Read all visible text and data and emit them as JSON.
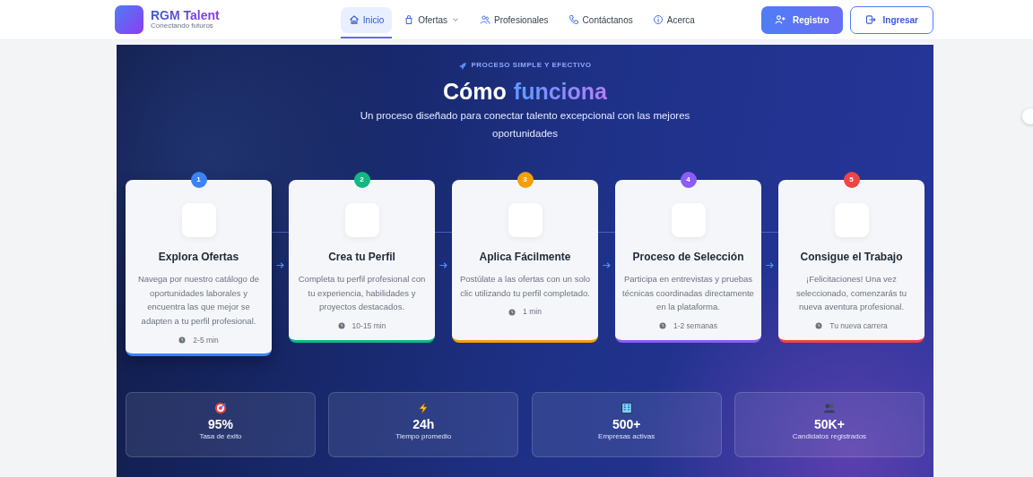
{
  "brand": {
    "name": "RGM Talent",
    "tagline": "Conectando futuros"
  },
  "nav": [
    {
      "label": "Inicio",
      "selected": true,
      "dropdown": false
    },
    {
      "label": "Ofertas",
      "selected": false,
      "dropdown": true
    },
    {
      "label": "Profesionales",
      "selected": false,
      "dropdown": false
    },
    {
      "label": "Contáctanos",
      "selected": false,
      "dropdown": false
    },
    {
      "label": "Acerca",
      "selected": false,
      "dropdown": false
    }
  ],
  "actions": [
    {
      "label": "Registro",
      "kind": "primary"
    },
    {
      "label": "Ingresar",
      "kind": "outline"
    }
  ],
  "hero": {
    "eyebrow": "PROCESO SIMPLE Y EFECTIVO",
    "title_lead": "Cómo",
    "title_highlight": "funciona",
    "subtitle": "Un proceso diseñado para conectar talento excepcional con las mejores oportunidades"
  },
  "steps": [
    {
      "number": "1",
      "title": "Explora Ofertas",
      "text": "Navega por nuestro catálogo de oportunidades laborales y encuentra las que mejor se adapten a tu perfil profesional.",
      "time": "2-5 min",
      "color": "#3b82f6",
      "selected": true
    },
    {
      "number": "2",
      "title": "Crea tu Perfil",
      "text": "Completa tu perfil profesional con tu experiencia, habilidades y proyectos destacados.",
      "time": "10-15 min",
      "color": "#10b981",
      "selected": false
    },
    {
      "number": "3",
      "title": "Aplica Fácilmente",
      "text": "Postúlate a las ofertas con un solo clic utilizando tu perfil completado.",
      "time": "1 min",
      "color": "#f59e0b",
      "selected": false
    },
    {
      "number": "4",
      "title": "Proceso de Selección",
      "text": "Participa en entrevistas y pruebas técnicas coordinadas directamente en la plataforma.",
      "time": "1-2 semanas",
      "color": "#8b5cf6",
      "selected": false
    },
    {
      "number": "5",
      "title": "Consigue el Trabajo",
      "text": "¡Felicitaciones! Una vez seleccionado, comenzarás tu nueva aventura profesional.",
      "time": "Tu nueva carrera",
      "color": "#ef4444",
      "selected": false
    }
  ],
  "stats": [
    {
      "value": "95%",
      "label": "Tasa de éxito"
    },
    {
      "value": "24h",
      "label": "Tiempo promedio"
    },
    {
      "value": "500+",
      "label": "Empresas activas"
    },
    {
      "value": "50K+",
      "label": "Candidatos registrados"
    }
  ]
}
